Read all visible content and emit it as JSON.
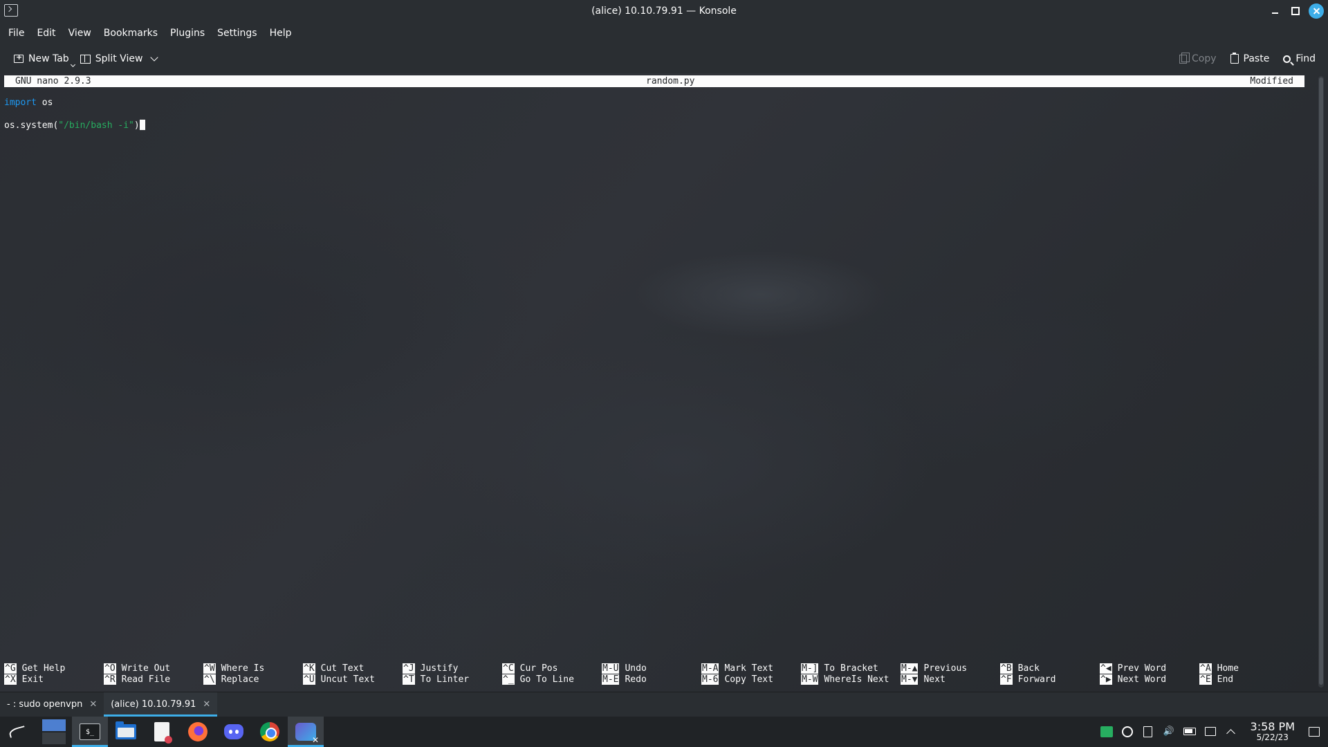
{
  "window": {
    "title": "(alice) 10.10.79.91 — Konsole"
  },
  "menubar": {
    "items": [
      "File",
      "Edit",
      "View",
      "Bookmarks",
      "Plugins",
      "Settings",
      "Help"
    ]
  },
  "toolbar": {
    "new_tab": "New Tab",
    "split_view": "Split View",
    "copy": "Copy",
    "paste": "Paste",
    "find": "Find"
  },
  "nano": {
    "version": "GNU nano 2.9.3",
    "filename": "random.py",
    "status": "Modified",
    "lines": {
      "line1_keyword": "import",
      "line1_rest": " os",
      "line2_prefix": "os.system(",
      "line2_string": "\"/bin/bash -i\"",
      "line2_suffix": ")"
    },
    "shortcuts": [
      {
        "k1": "^G",
        "l1": "Get Help",
        "k2": "^X",
        "l2": "Exit"
      },
      {
        "k1": "^O",
        "l1": "Write Out",
        "k2": "^R",
        "l2": "Read File"
      },
      {
        "k1": "^W",
        "l1": "Where Is",
        "k2": "^\\",
        "l2": "Replace"
      },
      {
        "k1": "^K",
        "l1": "Cut Text",
        "k2": "^U",
        "l2": "Uncut Text"
      },
      {
        "k1": "^J",
        "l1": "Justify",
        "k2": "^T",
        "l2": "To Linter"
      },
      {
        "k1": "^C",
        "l1": "Cur Pos",
        "k2": "^_",
        "l2": "Go To Line"
      },
      {
        "k1": "M-U",
        "l1": "Undo",
        "k2": "M-E",
        "l2": "Redo"
      },
      {
        "k1": "M-A",
        "l1": "Mark Text",
        "k2": "M-6",
        "l2": "Copy Text"
      },
      {
        "k1": "M-]",
        "l1": "To Bracket",
        "k2": "M-W",
        "l2": "WhereIs Next"
      },
      {
        "k1": "M-▲",
        "l1": "Previous",
        "k2": "M-▼",
        "l2": "Next"
      },
      {
        "k1": "^B",
        "l1": "Back",
        "k2": "^F",
        "l2": "Forward"
      },
      {
        "k1": "^◀",
        "l1": "Prev Word",
        "k2": "^▶",
        "l2": "Next Word"
      },
      {
        "k1": "^A",
        "l1": "Home",
        "k2": "^E",
        "l2": "End"
      }
    ]
  },
  "tabs": [
    {
      "label": "- : sudo openvpn",
      "active": false
    },
    {
      "label": "(alice) 10.10.79.91",
      "active": true
    }
  ],
  "taskbar": {
    "terminal_icon_text": "$_",
    "clock_time": "3:58 PM",
    "clock_date": "5/22/23"
  },
  "colors": {
    "accent": "#3daee9",
    "keyword": "#1d99f3",
    "string": "#27ae60",
    "background": "#232629"
  },
  "icons": {
    "titlebar": "konsole-icon",
    "toolbar": [
      "new-tab-icon",
      "split-view-icon",
      "chevron-down-icon",
      "copy-icon",
      "paste-icon",
      "search-icon"
    ],
    "taskbar": [
      "kali-menu-icon",
      "desktop-pager-icon",
      "terminal-icon",
      "file-manager-icon",
      "text-editor-icon",
      "firefox-icon",
      "discord-icon",
      "chrome-icon",
      "vpn-app-icon"
    ],
    "tray": [
      "network-icon",
      "update-icon",
      "clipboard-icon",
      "volume-icon",
      "battery-icon",
      "display-icon",
      "expand-tray-icon",
      "show-desktop-icon"
    ]
  }
}
